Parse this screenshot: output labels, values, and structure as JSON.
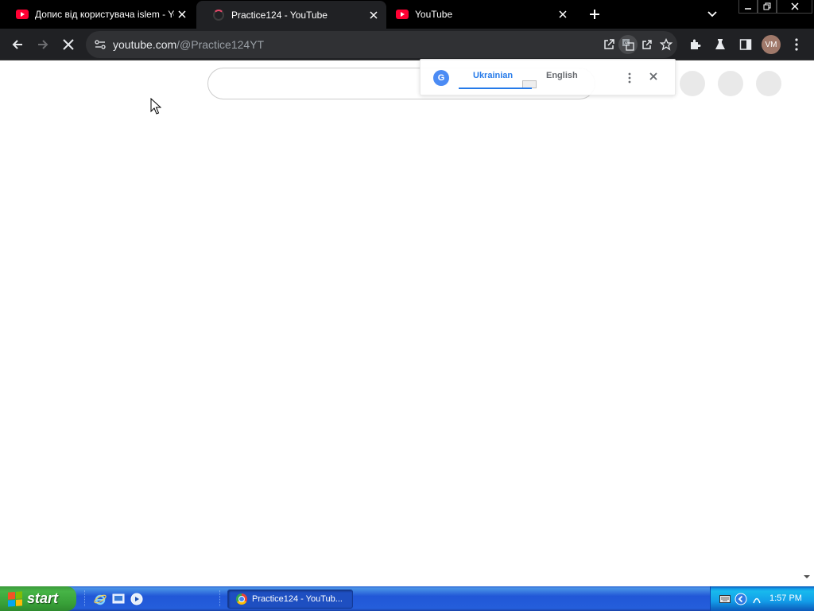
{
  "browser": {
    "tabs": [
      {
        "title": "Допис від користувача islem - YouTube",
        "favicon": "youtube-icon",
        "active": false
      },
      {
        "title": "Practice124 - YouTube",
        "favicon": "loading-icon",
        "active": true
      },
      {
        "title": "YouTube",
        "favicon": "youtube-icon",
        "active": false
      }
    ],
    "address": {
      "host": "youtube.com",
      "path": "/@Practice124YT"
    },
    "profile_initials": "VM"
  },
  "translate_popup": {
    "source_language": "Ukrainian",
    "target_language": "English"
  },
  "taskbar": {
    "start_label": "start",
    "window_button": "Practice124 - YouTub...",
    "clock": "1:57 PM"
  },
  "colors": {
    "tab_strip": "#000000",
    "toolbar": "#202124",
    "translate_accent": "#1a73e8",
    "taskbar_blue": "#245edb",
    "start_green": "#38a038"
  }
}
